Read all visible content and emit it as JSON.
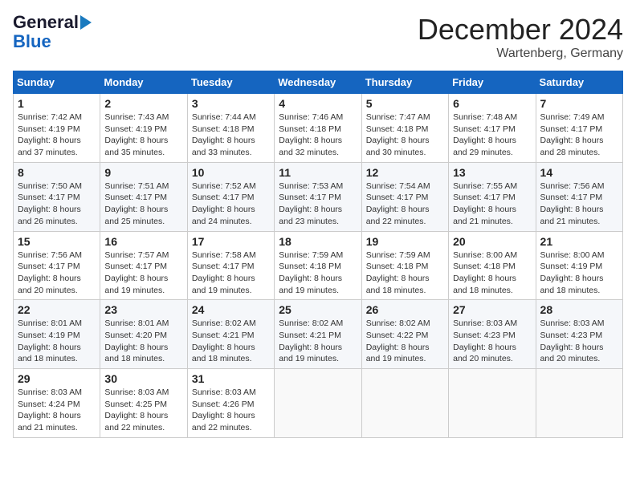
{
  "logo": {
    "line1": "General",
    "line2": "Blue",
    "arrow": "▶"
  },
  "title": "December 2024",
  "location": "Wartenberg, Germany",
  "days_of_week": [
    "Sunday",
    "Monday",
    "Tuesday",
    "Wednesday",
    "Thursday",
    "Friday",
    "Saturday"
  ],
  "weeks": [
    [
      {
        "day": "1",
        "info": "Sunrise: 7:42 AM\nSunset: 4:19 PM\nDaylight: 8 hours\nand 37 minutes."
      },
      {
        "day": "2",
        "info": "Sunrise: 7:43 AM\nSunset: 4:19 PM\nDaylight: 8 hours\nand 35 minutes."
      },
      {
        "day": "3",
        "info": "Sunrise: 7:44 AM\nSunset: 4:18 PM\nDaylight: 8 hours\nand 33 minutes."
      },
      {
        "day": "4",
        "info": "Sunrise: 7:46 AM\nSunset: 4:18 PM\nDaylight: 8 hours\nand 32 minutes."
      },
      {
        "day": "5",
        "info": "Sunrise: 7:47 AM\nSunset: 4:18 PM\nDaylight: 8 hours\nand 30 minutes."
      },
      {
        "day": "6",
        "info": "Sunrise: 7:48 AM\nSunset: 4:17 PM\nDaylight: 8 hours\nand 29 minutes."
      },
      {
        "day": "7",
        "info": "Sunrise: 7:49 AM\nSunset: 4:17 PM\nDaylight: 8 hours\nand 28 minutes."
      }
    ],
    [
      {
        "day": "8",
        "info": "Sunrise: 7:50 AM\nSunset: 4:17 PM\nDaylight: 8 hours\nand 26 minutes."
      },
      {
        "day": "9",
        "info": "Sunrise: 7:51 AM\nSunset: 4:17 PM\nDaylight: 8 hours\nand 25 minutes."
      },
      {
        "day": "10",
        "info": "Sunrise: 7:52 AM\nSunset: 4:17 PM\nDaylight: 8 hours\nand 24 minutes."
      },
      {
        "day": "11",
        "info": "Sunrise: 7:53 AM\nSunset: 4:17 PM\nDaylight: 8 hours\nand 23 minutes."
      },
      {
        "day": "12",
        "info": "Sunrise: 7:54 AM\nSunset: 4:17 PM\nDaylight: 8 hours\nand 22 minutes."
      },
      {
        "day": "13",
        "info": "Sunrise: 7:55 AM\nSunset: 4:17 PM\nDaylight: 8 hours\nand 21 minutes."
      },
      {
        "day": "14",
        "info": "Sunrise: 7:56 AM\nSunset: 4:17 PM\nDaylight: 8 hours\nand 21 minutes."
      }
    ],
    [
      {
        "day": "15",
        "info": "Sunrise: 7:56 AM\nSunset: 4:17 PM\nDaylight: 8 hours\nand 20 minutes."
      },
      {
        "day": "16",
        "info": "Sunrise: 7:57 AM\nSunset: 4:17 PM\nDaylight: 8 hours\nand 19 minutes."
      },
      {
        "day": "17",
        "info": "Sunrise: 7:58 AM\nSunset: 4:17 PM\nDaylight: 8 hours\nand 19 minutes."
      },
      {
        "day": "18",
        "info": "Sunrise: 7:59 AM\nSunset: 4:18 PM\nDaylight: 8 hours\nand 19 minutes."
      },
      {
        "day": "19",
        "info": "Sunrise: 7:59 AM\nSunset: 4:18 PM\nDaylight: 8 hours\nand 18 minutes."
      },
      {
        "day": "20",
        "info": "Sunrise: 8:00 AM\nSunset: 4:18 PM\nDaylight: 8 hours\nand 18 minutes."
      },
      {
        "day": "21",
        "info": "Sunrise: 8:00 AM\nSunset: 4:19 PM\nDaylight: 8 hours\nand 18 minutes."
      }
    ],
    [
      {
        "day": "22",
        "info": "Sunrise: 8:01 AM\nSunset: 4:19 PM\nDaylight: 8 hours\nand 18 minutes."
      },
      {
        "day": "23",
        "info": "Sunrise: 8:01 AM\nSunset: 4:20 PM\nDaylight: 8 hours\nand 18 minutes."
      },
      {
        "day": "24",
        "info": "Sunrise: 8:02 AM\nSunset: 4:21 PM\nDaylight: 8 hours\nand 18 minutes."
      },
      {
        "day": "25",
        "info": "Sunrise: 8:02 AM\nSunset: 4:21 PM\nDaylight: 8 hours\nand 19 minutes."
      },
      {
        "day": "26",
        "info": "Sunrise: 8:02 AM\nSunset: 4:22 PM\nDaylight: 8 hours\nand 19 minutes."
      },
      {
        "day": "27",
        "info": "Sunrise: 8:03 AM\nSunset: 4:23 PM\nDaylight: 8 hours\nand 20 minutes."
      },
      {
        "day": "28",
        "info": "Sunrise: 8:03 AM\nSunset: 4:23 PM\nDaylight: 8 hours\nand 20 minutes."
      }
    ],
    [
      {
        "day": "29",
        "info": "Sunrise: 8:03 AM\nSunset: 4:24 PM\nDaylight: 8 hours\nand 21 minutes."
      },
      {
        "day": "30",
        "info": "Sunrise: 8:03 AM\nSunset: 4:25 PM\nDaylight: 8 hours\nand 22 minutes."
      },
      {
        "day": "31",
        "info": "Sunrise: 8:03 AM\nSunset: 4:26 PM\nDaylight: 8 hours\nand 22 minutes."
      },
      {
        "day": "",
        "info": ""
      },
      {
        "day": "",
        "info": ""
      },
      {
        "day": "",
        "info": ""
      },
      {
        "day": "",
        "info": ""
      }
    ]
  ]
}
